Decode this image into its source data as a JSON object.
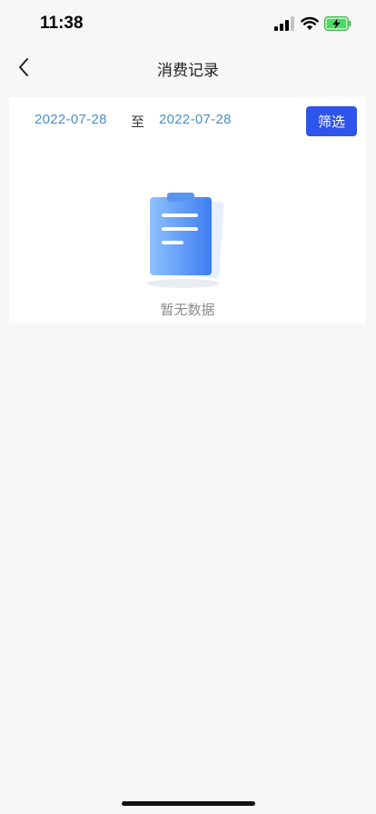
{
  "status_bar": {
    "time": "11:38",
    "icons": [
      "signal-icon",
      "wifi-icon",
      "battery-charging-icon"
    ]
  },
  "nav": {
    "back_icon": "chevron-left-icon",
    "title": "消费记录"
  },
  "filter": {
    "start_date": "2022-07-28",
    "separator": "至",
    "end_date": "2022-07-28",
    "button_label": "筛选"
  },
  "empty_state": {
    "icon": "clipboard-icon",
    "text": "暂无数据"
  },
  "colors": {
    "accent": "#2f54eb",
    "date_text": "#4a8fc7",
    "battery_green": "#4cd964",
    "page_bg": "#f7f7f7"
  }
}
